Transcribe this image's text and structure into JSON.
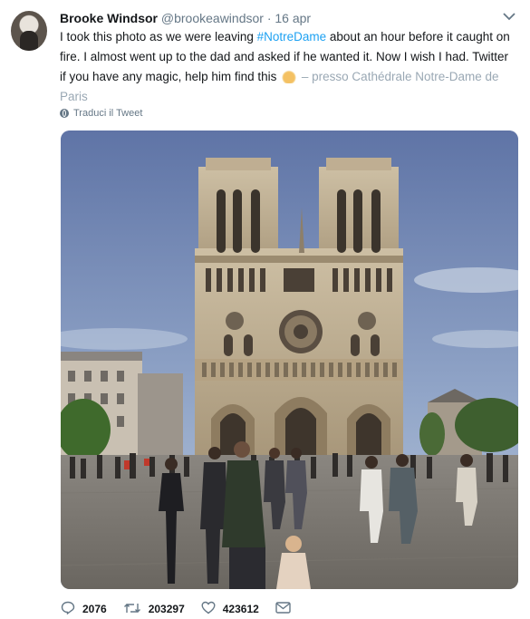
{
  "tweet": {
    "author_name": "Brooke Windsor",
    "author_handle": "@brookeawindsor",
    "separator": "·",
    "date": "16 apr",
    "text_part1": "I took this photo as we were leaving ",
    "hashtag": "#NotreDame",
    "text_part2": " about an hour before it caught on fire. I almost went up to the dad and asked if he wanted it. Now I wish I had. Twitter if you have any magic, help him find this ",
    "place": "– presso Cathédrale Notre-Dame de Paris",
    "translate_label": "Traduci il Tweet"
  },
  "actions": {
    "replies": "2076",
    "retweets": "203297",
    "likes": "423612"
  },
  "icons": {
    "reply": "reply-icon",
    "retweet": "retweet-icon",
    "like": "heart-icon",
    "message": "envelope-icon",
    "menu": "chevron-down-icon",
    "translate": "globe-icon"
  },
  "colors": {
    "link": "#1da1f2",
    "secondary": "#657786",
    "text": "#14171a"
  }
}
